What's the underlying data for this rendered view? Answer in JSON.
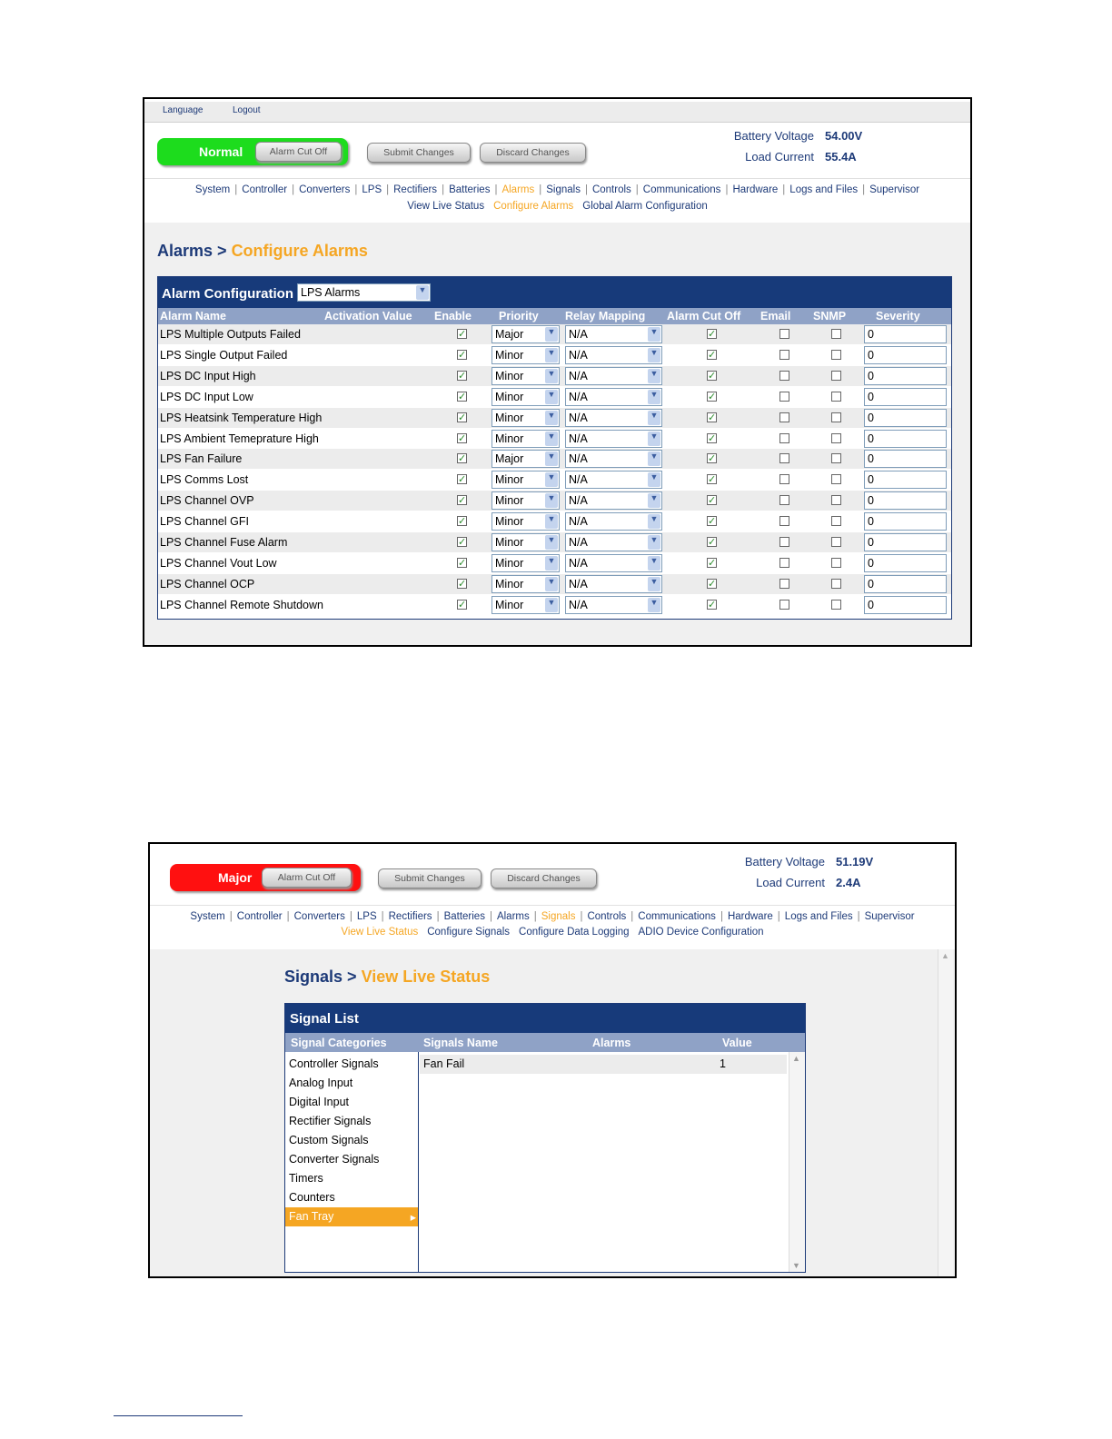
{
  "alarms_screen": {
    "top_links": [
      "Language",
      "Logout"
    ],
    "status": "Normal",
    "status_color": "#1ddc1d",
    "alarm_cut_off_label": "Alarm Cut Off",
    "submit_label": "Submit Changes",
    "discard_label": "Discard Changes",
    "battery_voltage_label": "Battery Voltage",
    "battery_voltage": "54.00V",
    "load_current_label": "Load Current",
    "load_current": "55.4A",
    "nav": [
      "System",
      "Controller",
      "Converters",
      "LPS",
      "Rectifiers",
      "Batteries",
      "Alarms",
      "Signals",
      "Controls",
      "Communications",
      "Hardware",
      "Logs and Files",
      "Supervisor"
    ],
    "nav_active": "Alarms",
    "subnav": [
      "View Live Status",
      "Configure Alarms",
      "Global Alarm Configuration"
    ],
    "subnav_active": "Configure Alarms",
    "breadcrumb_parent": "Alarms >",
    "breadcrumb_current": "Configure Alarms",
    "panel_title": "Alarm Configuration",
    "config_select": "LPS Alarms",
    "columns": [
      "Alarm Name",
      "Activation Value",
      "Enable",
      "Priority",
      "Relay Mapping",
      "Alarm Cut Off",
      "Email",
      "SNMP",
      "Severity"
    ],
    "rows": [
      {
        "name": "LPS Multiple Outputs Failed",
        "enable": true,
        "priority": "Major",
        "relay": "N/A",
        "cutoff": true,
        "email": false,
        "snmp": false,
        "severity": "0"
      },
      {
        "name": "LPS Single Output Failed",
        "enable": true,
        "priority": "Minor",
        "relay": "N/A",
        "cutoff": true,
        "email": false,
        "snmp": false,
        "severity": "0"
      },
      {
        "name": "LPS DC Input High",
        "enable": true,
        "priority": "Minor",
        "relay": "N/A",
        "cutoff": true,
        "email": false,
        "snmp": false,
        "severity": "0"
      },
      {
        "name": "LPS DC Input Low",
        "enable": true,
        "priority": "Minor",
        "relay": "N/A",
        "cutoff": true,
        "email": false,
        "snmp": false,
        "severity": "0"
      },
      {
        "name": "LPS Heatsink Temperature High",
        "enable": true,
        "priority": "Minor",
        "relay": "N/A",
        "cutoff": true,
        "email": false,
        "snmp": false,
        "severity": "0"
      },
      {
        "name": "LPS Ambient Temeprature High",
        "enable": true,
        "priority": "Minor",
        "relay": "N/A",
        "cutoff": true,
        "email": false,
        "snmp": false,
        "severity": "0"
      },
      {
        "name": "LPS Fan Failure",
        "enable": true,
        "priority": "Major",
        "relay": "N/A",
        "cutoff": true,
        "email": false,
        "snmp": false,
        "severity": "0"
      },
      {
        "name": "LPS Comms Lost",
        "enable": true,
        "priority": "Minor",
        "relay": "N/A",
        "cutoff": true,
        "email": false,
        "snmp": false,
        "severity": "0"
      },
      {
        "name": "LPS Channel OVP",
        "enable": true,
        "priority": "Minor",
        "relay": "N/A",
        "cutoff": true,
        "email": false,
        "snmp": false,
        "severity": "0"
      },
      {
        "name": "LPS Channel GFI",
        "enable": true,
        "priority": "Minor",
        "relay": "N/A",
        "cutoff": true,
        "email": false,
        "snmp": false,
        "severity": "0"
      },
      {
        "name": "LPS Channel Fuse Alarm",
        "enable": true,
        "priority": "Minor",
        "relay": "N/A",
        "cutoff": true,
        "email": false,
        "snmp": false,
        "severity": "0"
      },
      {
        "name": "LPS Channel Vout Low",
        "enable": true,
        "priority": "Minor",
        "relay": "N/A",
        "cutoff": true,
        "email": false,
        "snmp": false,
        "severity": "0"
      },
      {
        "name": "LPS Channel OCP",
        "enable": true,
        "priority": "Minor",
        "relay": "N/A",
        "cutoff": true,
        "email": false,
        "snmp": false,
        "severity": "0"
      },
      {
        "name": "LPS Channel Remote Shutdown",
        "enable": true,
        "priority": "Minor",
        "relay": "N/A",
        "cutoff": true,
        "email": false,
        "snmp": false,
        "severity": "0"
      }
    ]
  },
  "signals_screen": {
    "status": "Major",
    "status_color": "#ff1010",
    "alarm_cut_off_label": "Alarm Cut Off",
    "submit_label": "Submit Changes",
    "discard_label": "Discard Changes",
    "battery_voltage_label": "Battery Voltage",
    "battery_voltage": "51.19V",
    "load_current_label": "Load Current",
    "load_current": "2.4A",
    "nav": [
      "System",
      "Controller",
      "Converters",
      "LPS",
      "Rectifiers",
      "Batteries",
      "Alarms",
      "Signals",
      "Controls",
      "Communications",
      "Hardware",
      "Logs and Files",
      "Supervisor"
    ],
    "nav_active": "Signals",
    "subnav": [
      "View Live Status",
      "Configure Signals",
      "Configure Data Logging",
      "ADIO Device Configuration"
    ],
    "subnav_active": "View Live Status",
    "breadcrumb_parent": "Signals >",
    "breadcrumb_current": "View Live Status",
    "panel_title": "Signal List",
    "columns": [
      "Signal Categories",
      "Signals Name",
      "Alarms",
      "Value"
    ],
    "categories": [
      "Controller Signals",
      "Analog Input",
      "Digital Input",
      "Rectifier Signals",
      "Custom Signals",
      "Converter Signals",
      "Timers",
      "Counters",
      "Fan Tray"
    ],
    "selected_category": "Fan Tray",
    "signals": [
      {
        "name": "Fan Fail",
        "alarms": "",
        "value": "1"
      }
    ]
  }
}
